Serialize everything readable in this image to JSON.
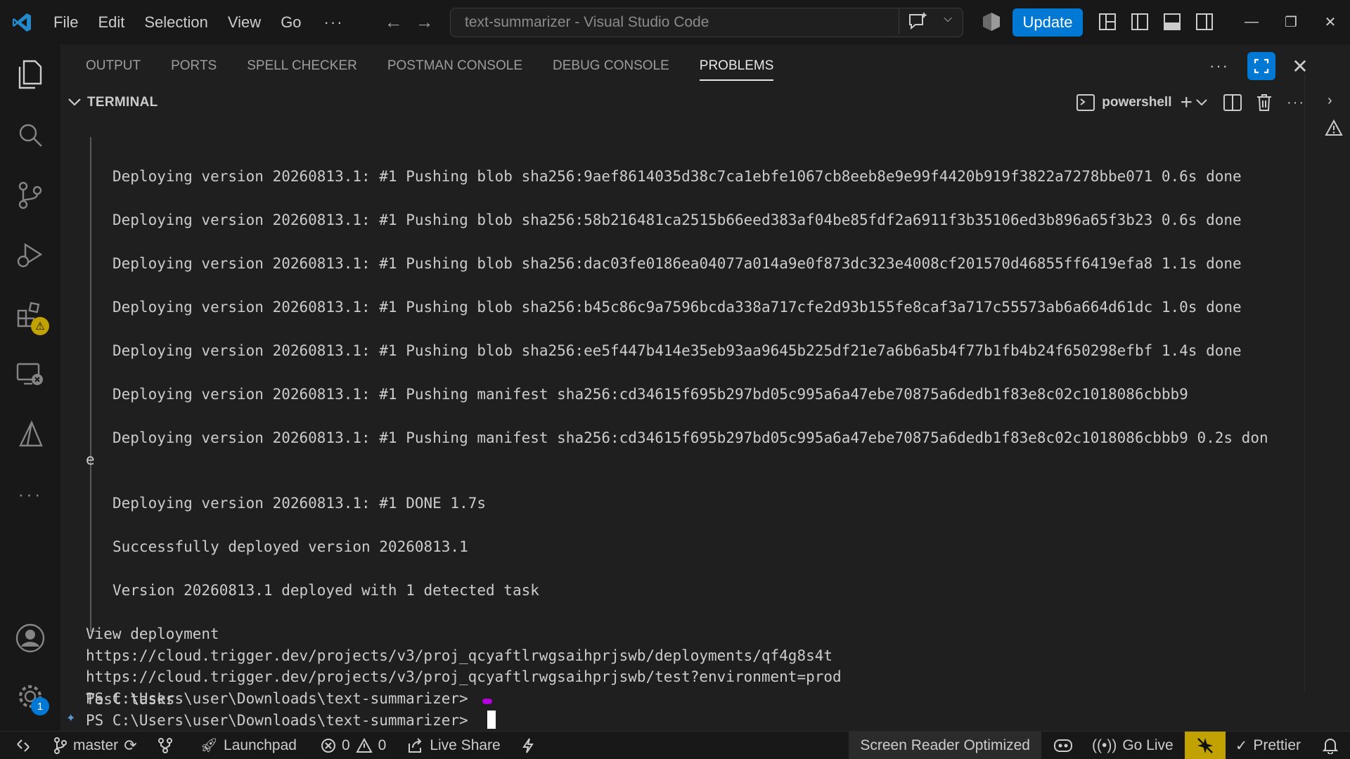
{
  "window": {
    "title": "text-summarizer - Visual Studio Code",
    "update_label": "Update"
  },
  "menu": [
    "File",
    "Edit",
    "Selection",
    "View",
    "Go"
  ],
  "menu_more": "···",
  "panel": {
    "tabs": [
      {
        "label": "OUTPUT",
        "active": false
      },
      {
        "label": "PORTS",
        "active": false
      },
      {
        "label": "SPELL CHECKER",
        "active": false
      },
      {
        "label": "POSTMAN CONSOLE",
        "active": false
      },
      {
        "label": "DEBUG CONSOLE",
        "active": false
      },
      {
        "label": "PROBLEMS",
        "active": true
      }
    ],
    "terminal_title": "TERMINAL",
    "shell_name": "powershell"
  },
  "activity": {
    "extensions_badge": "⚠",
    "settings_badge": "1"
  },
  "terminal": {
    "lines": [
      "Deploying version 20260813.1: #1 Pushing blob sha256:9aef8614035d38c7ca1ebfe1067cb8eeb8e9e99f4420b919f3822a7278bbe071 0.6s done",
      "Deploying version 20260813.1: #1 Pushing blob sha256:58b216481ca2515b66eed383af04be85fdf2a6911f3b35106ed3b896a65f3b23 0.6s done",
      "Deploying version 20260813.1: #1 Pushing blob sha256:dac03fe0186ea04077a014a9e0f873dc323e4008cf201570d46855ff6419efa8 1.1s done",
      "Deploying version 20260813.1: #1 Pushing blob sha256:b45c86c9a7596bcda338a717cfe2d93b155fe8caf3a717c55573ab6a664d61dc 1.0s done",
      "Deploying version 20260813.1: #1 Pushing blob sha256:ee5f447b414e35eb93aa9645b225df21e7a6b6a5b4f77b1fb4b24f650298efbf 1.4s done",
      "Deploying version 20260813.1: #1 Pushing manifest sha256:cd34615f695b297bd05c995a6a47ebe70875a6dedb1f83e8c02c1018086cbbb9",
      "Deploying version 20260813.1: #1 Pushing manifest sha256:cd34615f695b297bd05c995a6a47ebe70875a6dedb1f83e8c02c1018086cbbb9 0.2s don",
      "e",
      "Deploying version 20260813.1: #1 DONE 1.7s",
      "Successfully deployed version 20260813.1",
      "Version 20260813.1 deployed with 1 detected task",
      "View deployment",
      "https://cloud.trigger.dev/projects/v3/proj_qcyaftlrwgsaihprjswb/deployments/qf4g8s4t",
      "Test tasks",
      "https://cloud.trigger.dev/projects/v3/proj_qcyaftlrwgsaihprjswb/test?environment=prod",
      "PS C:\\Users\\user\\Downloads\\text-summarizer>",
      "PS C:\\Users\\user\\Downloads\\text-summarizer>"
    ]
  },
  "statusbar": {
    "branch": "master",
    "launchpad": "Launchpad",
    "errors": "0",
    "warnings": "0",
    "live_share": "Live Share",
    "screen_reader": "Screen Reader Optimized",
    "go_live": "Go Live",
    "prettier": "Prettier"
  },
  "colors": {
    "accent": "#0078d4",
    "badge_blue": "#0078d4",
    "warning_badge": "#c1a200",
    "terminal_mark": "#b000d8"
  }
}
